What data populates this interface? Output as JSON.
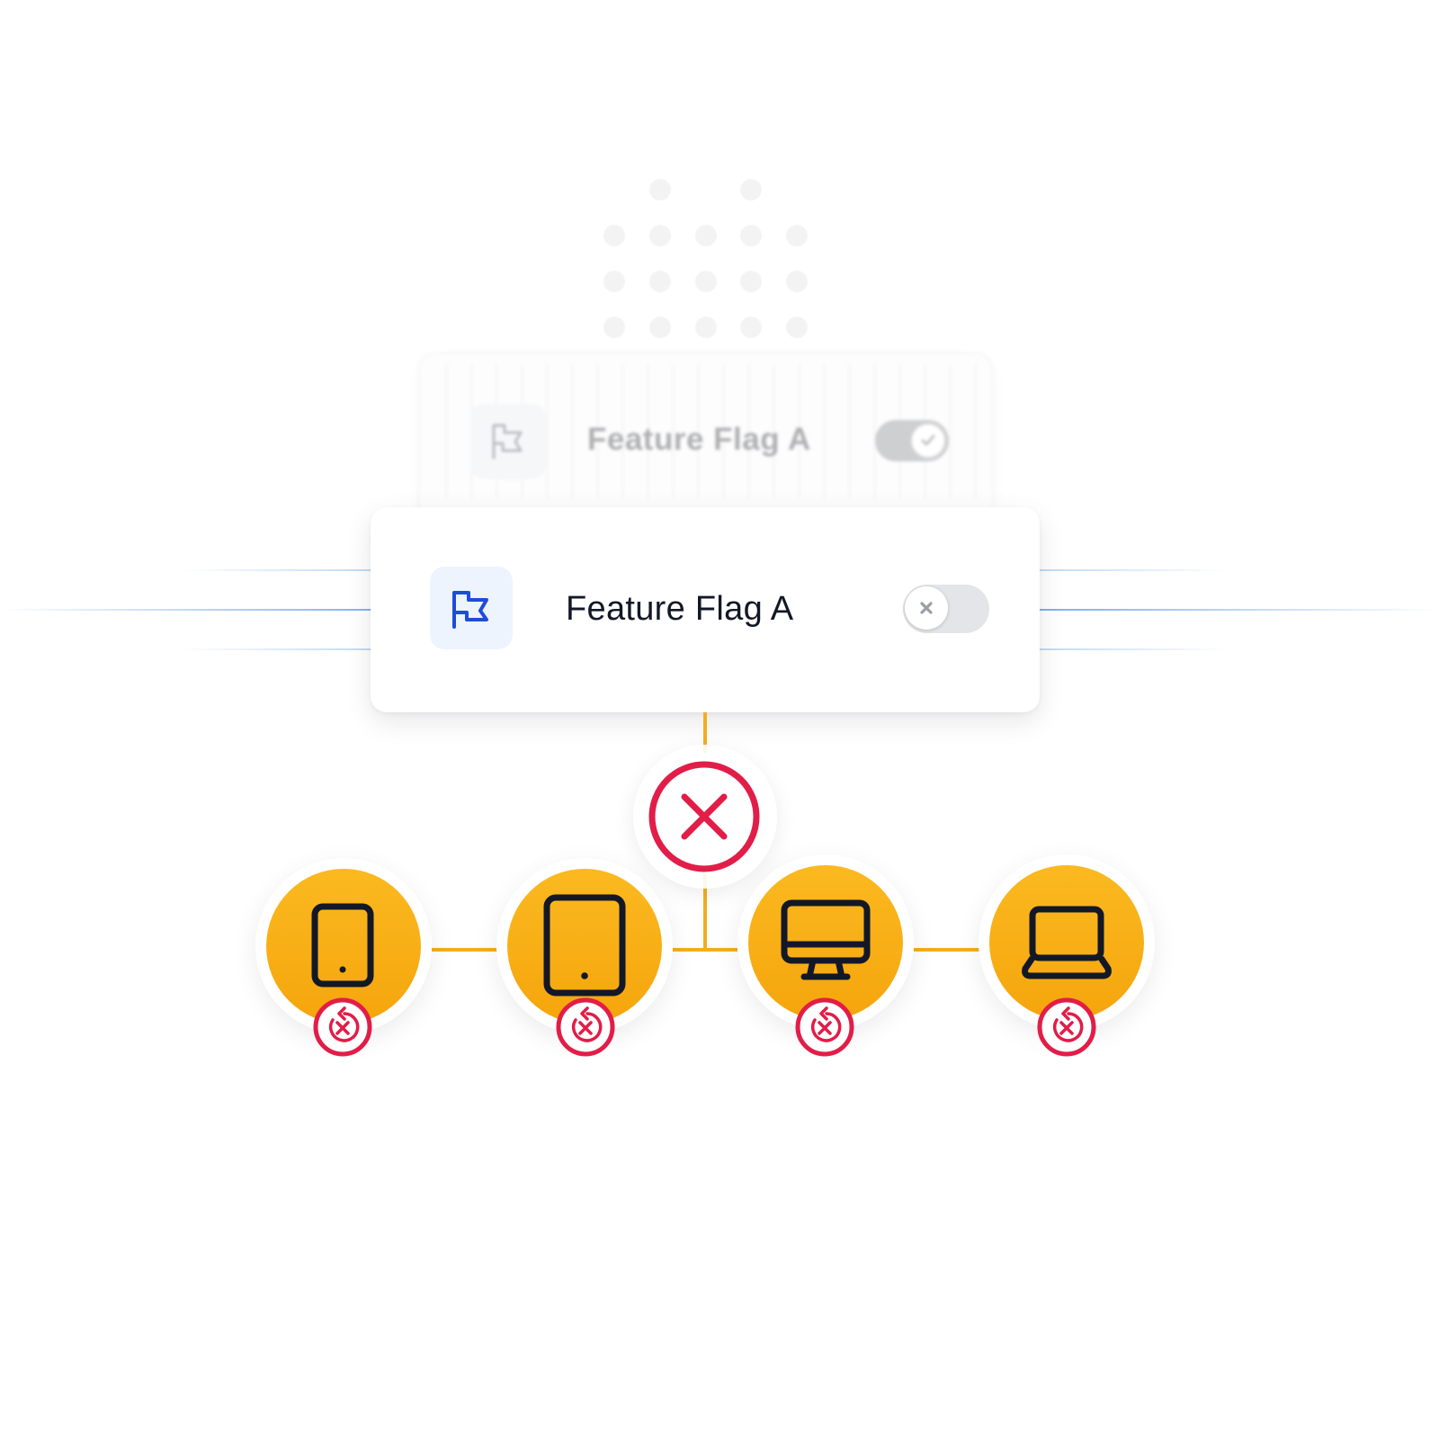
{
  "background_card": {
    "title": "Feature Flag A",
    "toggle_state": "on"
  },
  "feature_card": {
    "title": "Feature Flag A",
    "icon": "flag-icon",
    "toggle_state": "off",
    "toggle_icon": "x-icon"
  },
  "status": {
    "icon": "x-circle-icon",
    "meaning": "disabled"
  },
  "devices": [
    {
      "name": "phone",
      "icon": "smartphone-icon",
      "badge_icon": "rollback-x-icon"
    },
    {
      "name": "tablet",
      "icon": "tablet-icon",
      "badge_icon": "rollback-x-icon"
    },
    {
      "name": "desktop",
      "icon": "desktop-icon",
      "badge_icon": "rollback-x-icon"
    },
    {
      "name": "laptop",
      "icon": "laptop-icon",
      "badge_icon": "rollback-x-icon"
    }
  ],
  "colors": {
    "accent_blue": "#1d4ed8",
    "error_red": "#e11d48",
    "node_orange": "#f5a50c",
    "connector": "#f2ae20",
    "text_dark": "#121826"
  }
}
